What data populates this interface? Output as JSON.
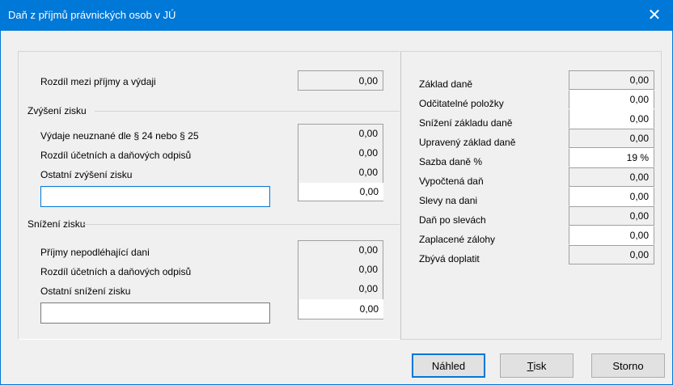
{
  "window": {
    "title": "Daň z příjmů právnických osob v JÚ",
    "close_glyph": "✕"
  },
  "left": {
    "diff_label": "Rozdíl mezi příjmy a výdaji",
    "diff_value": "0,00",
    "increase": {
      "group_label": "Zvýšení zisku",
      "rows": [
        {
          "label": "Výdaje neuznané dle § 24 nebo § 25",
          "value": "0,00"
        },
        {
          "label": "Rozdíl účetních a daňových odpisů",
          "value": "0,00"
        },
        {
          "label": "Ostatní zvýšení zisku",
          "value": "0,00"
        }
      ],
      "custom_label_value": "",
      "custom_value": "0,00"
    },
    "decrease": {
      "group_label": "Snížení zisku",
      "rows": [
        {
          "label": "Příjmy nepodléhající dani",
          "value": "0,00"
        },
        {
          "label": "Rozdíl účetních a daňových odpisů",
          "value": "0,00"
        },
        {
          "label": "Ostatní snížení zisku",
          "value": "0,00"
        }
      ],
      "custom_label_value": "",
      "custom_value": "0,00"
    }
  },
  "right": {
    "rows": [
      {
        "label": "Základ daně",
        "value": "0,00"
      },
      {
        "label": "Odčitatelné položky",
        "value": "0,00"
      },
      {
        "label": "Snížení základu daně",
        "value": "0,00"
      },
      {
        "label": "Upravený základ daně",
        "value": "0,00"
      },
      {
        "label": "Sazba daně %",
        "value": "19 %"
      },
      {
        "label": "Vypočtená daň",
        "value": "0,00"
      },
      {
        "label": "Slevy na dani",
        "value": "0,00"
      },
      {
        "label": "Daň po slevách",
        "value": "0,00"
      },
      {
        "label": "Zaplacené zálohy",
        "value": "0,00"
      },
      {
        "label": "Zbývá doplatit",
        "value": "0,00"
      }
    ]
  },
  "buttons": {
    "preview": "Náhled",
    "print_accel": "T",
    "print_rest": "isk",
    "cancel": "Storno"
  }
}
